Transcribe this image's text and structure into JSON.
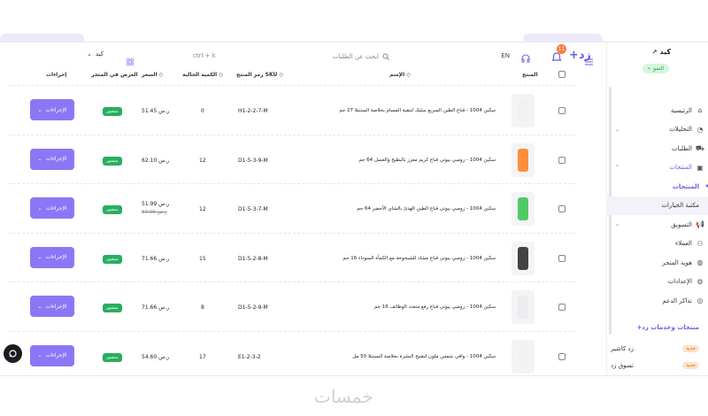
{
  "header": {
    "logo": "زد+",
    "notification_count": "11",
    "language": "EN",
    "search_placeholder": "ابحث عن الطلبات",
    "shortcut": "ctrl + k",
    "store_selector": "كيد"
  },
  "sidebar": {
    "store_name": "كيد",
    "store_status": "النمو",
    "items": [
      {
        "label": "الرئيسية",
        "icon": "home-icon"
      },
      {
        "label": "التحليلات",
        "icon": "chart-icon"
      },
      {
        "label": "الطلبات",
        "icon": "cart-icon"
      },
      {
        "label": "المنتجات",
        "icon": "box-icon"
      },
      {
        "label": "المنتجات",
        "icon": "dot-icon"
      },
      {
        "label": "مكتبة الخيارات",
        "icon": "none"
      },
      {
        "label": "التسويق",
        "icon": "megaphone-icon"
      },
      {
        "label": "العملاء",
        "icon": "users-icon"
      },
      {
        "label": "هوية المتجر",
        "icon": "palette-icon"
      },
      {
        "label": "الإعدادات",
        "icon": "gear-icon"
      },
      {
        "label": "تذاكر الدعم",
        "icon": "support-icon"
      }
    ],
    "services_title": "منتجات وخدمات زد+",
    "services": [
      {
        "label": "زد كاشير",
        "badge": "جديد"
      },
      {
        "label": "تسوق زد",
        "badge": "جديد"
      }
    ]
  },
  "table": {
    "headers": {
      "product": "المنتج",
      "name": "الإسم",
      "sku": "رمز المنتج SKU",
      "qty": "الكمية الحالية",
      "price": "السعر",
      "status": "العرض في المتجر",
      "actions": "إجراءات"
    },
    "action_label": "الإجراءات",
    "rows": [
      {
        "name": "سكين 1004 - قناع الطين السريع سليك لتنقية المسام بخلاصة السنتيلا 27 جم",
        "sku": "H1-2-2-7-M",
        "qty": "0",
        "price": "51.45 ر.س",
        "old_price": "",
        "status": "منشور"
      },
      {
        "name": "سكين 1004 - زومبي بيوتي قناع كريم معزز بالبطيخ والعسل 64 جم",
        "sku": "D1-5-3-9-M",
        "qty": "12",
        "price": "62.10 ر.س",
        "old_price": "",
        "status": "منشور"
      },
      {
        "name": "سكين 1004 - زومبي بيوتي قناع الطين الهدئ بالشاي الأخضر 64 جم",
        "sku": "D1-5-3-7-M",
        "qty": "12",
        "price": "51.99 ر.س",
        "old_price": "60.05 ر.س",
        "status": "منشور"
      },
      {
        "name": "سكين 1004 - زومبي بيوتي قناع مشاد للشيخوخة مع الكمأة السوداء 16 جم",
        "sku": "D1-5-2-8-M",
        "qty": "15",
        "price": "71.66 ر.س",
        "old_price": "",
        "status": "منشور"
      },
      {
        "name": "سكين 1004 - زومبي بيوتي قناع رفع متعدد الوظائف 16 جم",
        "sku": "D1-5-2-9-M",
        "qty": "8",
        "price": "71.66 ر.س",
        "old_price": "",
        "status": "منشور"
      },
      {
        "name": "سكين 1004 - واقي شمس ملون لتفتيح البشرة بخلاصة السنتيلا 50 مل",
        "sku": "E1-2-3-2",
        "qty": "17",
        "price": "54.60 ر.س",
        "old_price": "",
        "status": "منشور"
      }
    ]
  },
  "watermark": "خمسات",
  "colors": {
    "accent": "#8b77f5",
    "published": "#27ae60",
    "badge": "#ff7a3d"
  }
}
